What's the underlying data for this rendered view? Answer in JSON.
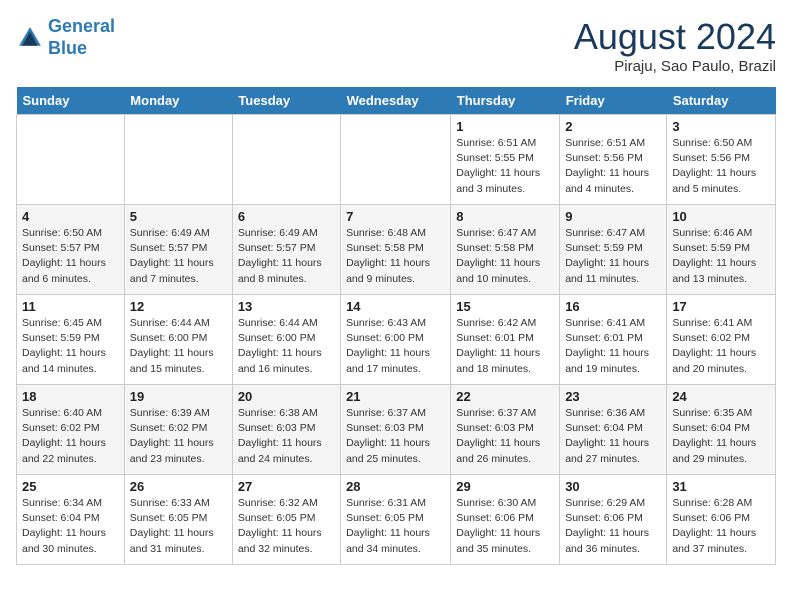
{
  "header": {
    "logo_line1": "General",
    "logo_line2": "Blue",
    "month_title": "August 2024",
    "location": "Piraju, Sao Paulo, Brazil"
  },
  "weekdays": [
    "Sunday",
    "Monday",
    "Tuesday",
    "Wednesday",
    "Thursday",
    "Friday",
    "Saturday"
  ],
  "weeks": [
    [
      {
        "day": "",
        "info": ""
      },
      {
        "day": "",
        "info": ""
      },
      {
        "day": "",
        "info": ""
      },
      {
        "day": "",
        "info": ""
      },
      {
        "day": "1",
        "info": "Sunrise: 6:51 AM\nSunset: 5:55 PM\nDaylight: 11 hours and 3 minutes."
      },
      {
        "day": "2",
        "info": "Sunrise: 6:51 AM\nSunset: 5:56 PM\nDaylight: 11 hours and 4 minutes."
      },
      {
        "day": "3",
        "info": "Sunrise: 6:50 AM\nSunset: 5:56 PM\nDaylight: 11 hours and 5 minutes."
      }
    ],
    [
      {
        "day": "4",
        "info": "Sunrise: 6:50 AM\nSunset: 5:57 PM\nDaylight: 11 hours and 6 minutes."
      },
      {
        "day": "5",
        "info": "Sunrise: 6:49 AM\nSunset: 5:57 PM\nDaylight: 11 hours and 7 minutes."
      },
      {
        "day": "6",
        "info": "Sunrise: 6:49 AM\nSunset: 5:57 PM\nDaylight: 11 hours and 8 minutes."
      },
      {
        "day": "7",
        "info": "Sunrise: 6:48 AM\nSunset: 5:58 PM\nDaylight: 11 hours and 9 minutes."
      },
      {
        "day": "8",
        "info": "Sunrise: 6:47 AM\nSunset: 5:58 PM\nDaylight: 11 hours and 10 minutes."
      },
      {
        "day": "9",
        "info": "Sunrise: 6:47 AM\nSunset: 5:59 PM\nDaylight: 11 hours and 11 minutes."
      },
      {
        "day": "10",
        "info": "Sunrise: 6:46 AM\nSunset: 5:59 PM\nDaylight: 11 hours and 13 minutes."
      }
    ],
    [
      {
        "day": "11",
        "info": "Sunrise: 6:45 AM\nSunset: 5:59 PM\nDaylight: 11 hours and 14 minutes."
      },
      {
        "day": "12",
        "info": "Sunrise: 6:44 AM\nSunset: 6:00 PM\nDaylight: 11 hours and 15 minutes."
      },
      {
        "day": "13",
        "info": "Sunrise: 6:44 AM\nSunset: 6:00 PM\nDaylight: 11 hours and 16 minutes."
      },
      {
        "day": "14",
        "info": "Sunrise: 6:43 AM\nSunset: 6:00 PM\nDaylight: 11 hours and 17 minutes."
      },
      {
        "day": "15",
        "info": "Sunrise: 6:42 AM\nSunset: 6:01 PM\nDaylight: 11 hours and 18 minutes."
      },
      {
        "day": "16",
        "info": "Sunrise: 6:41 AM\nSunset: 6:01 PM\nDaylight: 11 hours and 19 minutes."
      },
      {
        "day": "17",
        "info": "Sunrise: 6:41 AM\nSunset: 6:02 PM\nDaylight: 11 hours and 20 minutes."
      }
    ],
    [
      {
        "day": "18",
        "info": "Sunrise: 6:40 AM\nSunset: 6:02 PM\nDaylight: 11 hours and 22 minutes."
      },
      {
        "day": "19",
        "info": "Sunrise: 6:39 AM\nSunset: 6:02 PM\nDaylight: 11 hours and 23 minutes."
      },
      {
        "day": "20",
        "info": "Sunrise: 6:38 AM\nSunset: 6:03 PM\nDaylight: 11 hours and 24 minutes."
      },
      {
        "day": "21",
        "info": "Sunrise: 6:37 AM\nSunset: 6:03 PM\nDaylight: 11 hours and 25 minutes."
      },
      {
        "day": "22",
        "info": "Sunrise: 6:37 AM\nSunset: 6:03 PM\nDaylight: 11 hours and 26 minutes."
      },
      {
        "day": "23",
        "info": "Sunrise: 6:36 AM\nSunset: 6:04 PM\nDaylight: 11 hours and 27 minutes."
      },
      {
        "day": "24",
        "info": "Sunrise: 6:35 AM\nSunset: 6:04 PM\nDaylight: 11 hours and 29 minutes."
      }
    ],
    [
      {
        "day": "25",
        "info": "Sunrise: 6:34 AM\nSunset: 6:04 PM\nDaylight: 11 hours and 30 minutes."
      },
      {
        "day": "26",
        "info": "Sunrise: 6:33 AM\nSunset: 6:05 PM\nDaylight: 11 hours and 31 minutes."
      },
      {
        "day": "27",
        "info": "Sunrise: 6:32 AM\nSunset: 6:05 PM\nDaylight: 11 hours and 32 minutes."
      },
      {
        "day": "28",
        "info": "Sunrise: 6:31 AM\nSunset: 6:05 PM\nDaylight: 11 hours and 34 minutes."
      },
      {
        "day": "29",
        "info": "Sunrise: 6:30 AM\nSunset: 6:06 PM\nDaylight: 11 hours and 35 minutes."
      },
      {
        "day": "30",
        "info": "Sunrise: 6:29 AM\nSunset: 6:06 PM\nDaylight: 11 hours and 36 minutes."
      },
      {
        "day": "31",
        "info": "Sunrise: 6:28 AM\nSunset: 6:06 PM\nDaylight: 11 hours and 37 minutes."
      }
    ]
  ]
}
